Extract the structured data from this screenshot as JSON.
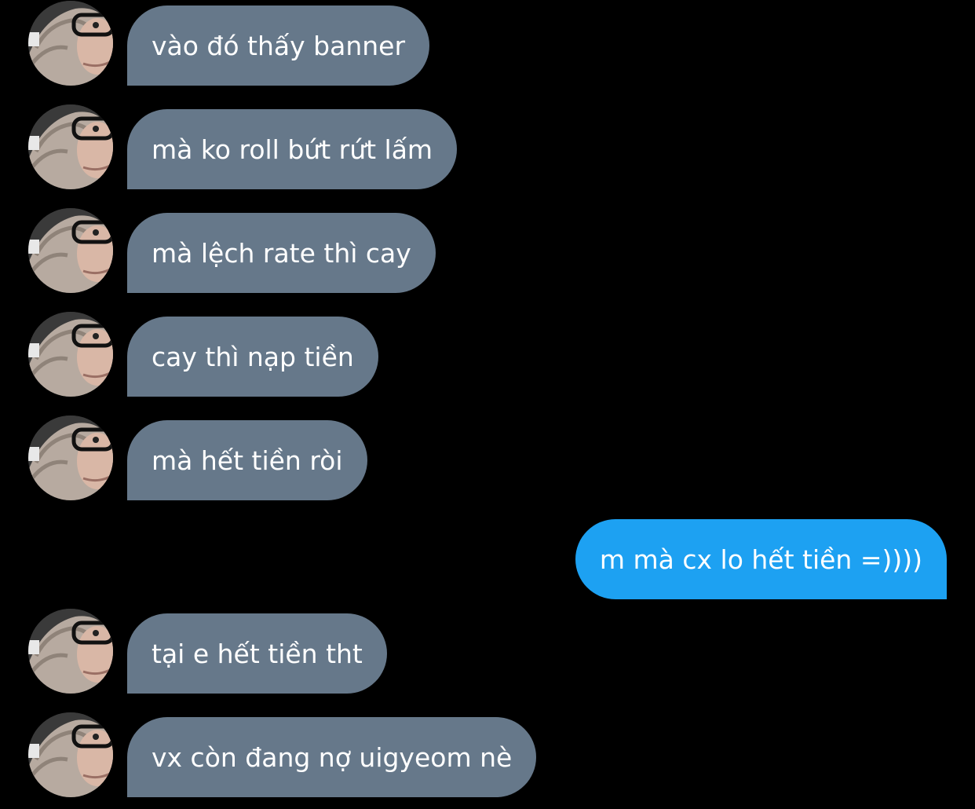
{
  "conversation": {
    "messages": [
      {
        "sender": "them",
        "text": "vào đó thấy banner"
      },
      {
        "sender": "them",
        "text": "mà ko roll bứt rứt lấm"
      },
      {
        "sender": "them",
        "text": "mà lệch rate thì cay"
      },
      {
        "sender": "them",
        "text": "cay thì nạp tiền"
      },
      {
        "sender": "them",
        "text": "mà hết tiền ròi"
      },
      {
        "sender": "me",
        "text": "m mà cx lo hết tiền =))))"
      },
      {
        "sender": "them",
        "text": "tại e hết tiền tht"
      },
      {
        "sender": "them",
        "text": "vx còn đang nợ uigyeom nè"
      }
    ]
  },
  "colors": {
    "background": "#000000",
    "incoming_bubble": "#66788a",
    "outgoing_bubble": "#1da1f2",
    "text": "#ffffff"
  }
}
